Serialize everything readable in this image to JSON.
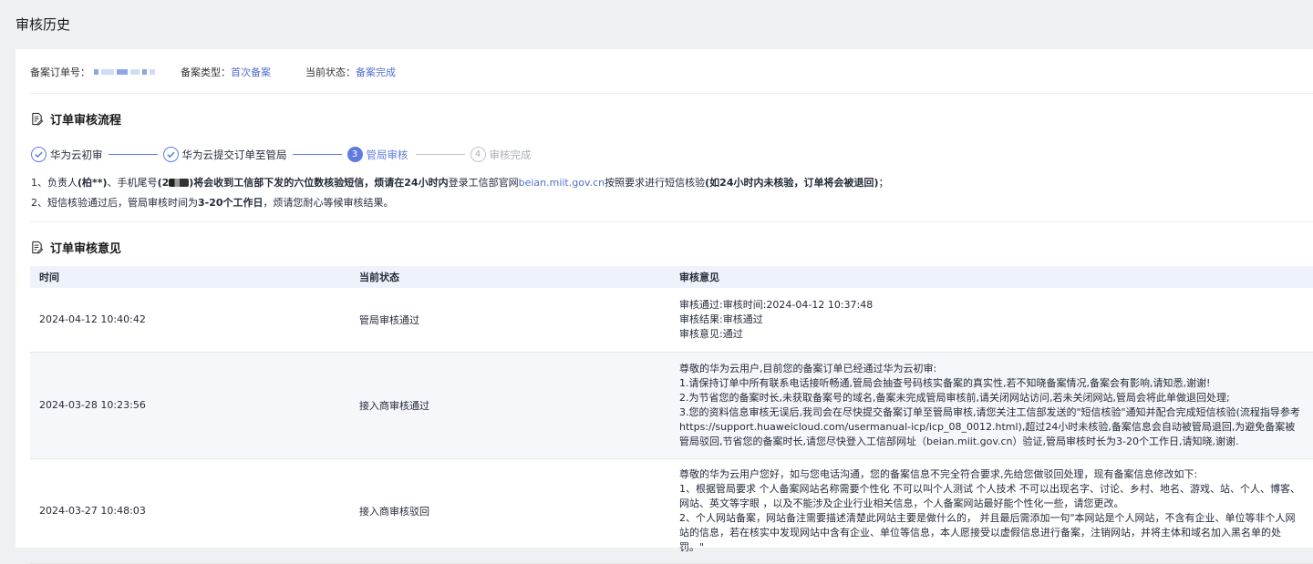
{
  "page": {
    "title": "审核历史"
  },
  "summary": {
    "order_no_label": "备案订单号：",
    "type_label": "备案类型：",
    "type_value": "首次备案",
    "status_label": "当前状态：",
    "status_value": "备案完成"
  },
  "flow": {
    "title": "订单审核流程",
    "steps": [
      {
        "label": "华为云初审",
        "state": "done"
      },
      {
        "label": "华为云提交订单至管局",
        "state": "done"
      },
      {
        "label": "管局审核",
        "state": "active",
        "num": "3"
      },
      {
        "label": "审核完成",
        "state": "todo",
        "num": "4"
      }
    ],
    "note1": {
      "p1": "1、负责人",
      "p2": "(柏**)",
      "p3": "、手机尾号",
      "p4": "(2",
      "p5": ")将会收到工信部下发的六位数核验短信，烦请在",
      "p6": "24小时内",
      "p7": "登录工信部官网",
      "link": "beian.miit.gov.cn",
      "p8": "按照要求进行短信核验",
      "p9": "(如24小时内未核验，订单将会被退回)",
      "p10": "；"
    },
    "note2": {
      "p1": "2、短信核验通过后，管局审核时间为",
      "p2": "3-20个工作日",
      "p3": "，烦请您耐心等候审核结果。"
    }
  },
  "opinions": {
    "title": "订单审核意见",
    "columns": [
      "时间",
      "当前状态",
      "审核意见"
    ],
    "rows": [
      {
        "time": "2024-04-12 10:40:42",
        "status": "管局审核通过",
        "lines": [
          "审核通过:审核时间:2024-04-12 10:37:48",
          "审核结果:审核通过",
          "审核意见:通过"
        ]
      },
      {
        "time": "2024-03-28 10:23:56",
        "status": "接入商审核通过",
        "lines": [
          "尊敬的华为云用户,目前您的备案订单已经通过华为云初审:",
          "1.请保持订单中所有联系电话接听畅通,管局会抽查号码核实备案的真实性,若不知晓备案情况,备案会有影响,请知悉,谢谢!",
          "2.为节省您的备案时长,未获取备案号的域名,备案未完成管局审核前,请关闭网站访问,若未关闭网站,管局会将此单做退回处理;",
          "3.您的资料信息审核无误后,我司会在尽快提交备案订单至管局审核,请您关注工信部发送的\"短信核验\"通知并配合完成短信核验(流程指导参考https://support.huaweicloud.com/usermanual-icp/icp_08_0012.html),超过24小时未核验,备案信息会自动被管局退回,为避免备案被管局驳回,节省您的备案时长,请您尽快登入工信部网址（beian.miit.gov.cn）验证,管局审核时长为3-20个工作日,请知晓,谢谢."
        ]
      },
      {
        "time": "2024-03-27 10:48:03",
        "status": "接入商审核驳回",
        "lines": [
          "尊敬的华为云用户您好，如与您电话沟通，您的备案信息不完全符合要求,先给您做驳回处理，现有备案信息修改如下:",
          "1、根据管局要求 个人备案网站名称需要个性化 不可以叫个人测试 个人技术 不可以出现名字、讨论、乡村、地名、游戏、站、个人、博客、网站、英文等字眼 ，以及不能涉及企业行业相关信息，个人备案网站最好能个性化一些，请您更改。",
          "2、个人网站备案，网站备注需要描述清楚此网站主要是做什么的， 并且最后需添加一句\"本网站是个人网站，不含有企业、单位等非个人网站的信息，若在核实中发现网站中含有企业、单位等信息，本人愿接受以虚假信息进行备案，注销网站，并将主体和域名加入黑名单的处罚。\""
        ]
      }
    ]
  }
}
